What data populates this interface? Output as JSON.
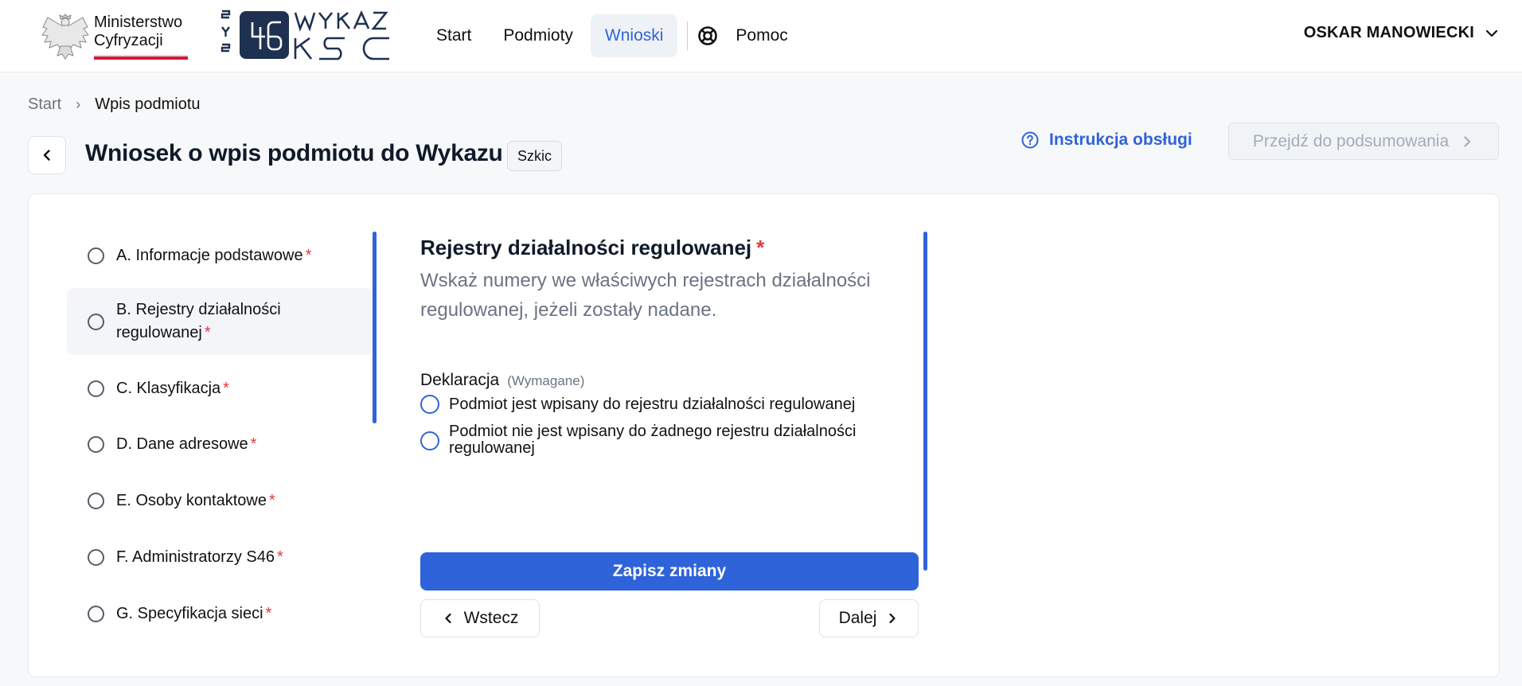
{
  "header": {
    "ministry_logo_text": "Ministerstwo Cyfryzacji",
    "ministry_line1": "Ministerstwo",
    "ministry_line2": "Cyfryzacji",
    "ksc_logo_text": "S46 WYKAZ KSC",
    "nav": [
      {
        "label": "Start",
        "active": false
      },
      {
        "label": "Podmioty",
        "active": false
      },
      {
        "label": "Wnioski",
        "active": true
      }
    ],
    "help_label": "Pomoc",
    "help_icon": "lifebuoy-icon",
    "user_name": "OSKAR MANOWIECKI"
  },
  "breadcrumb": {
    "items": [
      "Start",
      "Wpis podmiotu"
    ]
  },
  "title_row": {
    "title": "Wniosek o wpis podmiotu do Wykazu",
    "status_badge": "Szkic",
    "instruction_label": "Instrukcja obsługi",
    "summary_label": "Przejdź do podsumowania"
  },
  "steps": [
    {
      "label": "A. Informacje podstawowe",
      "required": "*"
    },
    {
      "label": "B. Rejestry działalności",
      "label2": "regulowanej",
      "required": "*"
    },
    {
      "label": "C. Klasyfikacja",
      "required": "*"
    },
    {
      "label": "D. Dane adresowe",
      "required": "*"
    },
    {
      "label": "E. Osoby kontaktowe",
      "required": "*"
    },
    {
      "label": "F. Administratorzy S46",
      "required": "*"
    },
    {
      "label": "G. Specyfikacja sieci",
      "required": "*"
    }
  ],
  "form": {
    "section_title": "Rejestry działalności regulowanej",
    "required_mark": "*",
    "description": "Wskaż numery we właściwych rejestrach działalności regulowanej, jeżeli zostały nadane.",
    "declaration_label": "Deklaracja",
    "declaration_hint": "(Wymagane)",
    "options": [
      "Podmiot jest wpisany do rejestru działalności regulowanej",
      "Podmiot nie jest wpisany do żadnego rejestru działalności regulowanej"
    ],
    "save_label": "Zapisz zmiany",
    "prev_label": "Wstecz",
    "next_label": "Dalej"
  },
  "colors": {
    "accent": "#2f63d9",
    "required": "#e5393b",
    "logo_dark": "#1e3150",
    "flag_red": "#dc143c"
  }
}
